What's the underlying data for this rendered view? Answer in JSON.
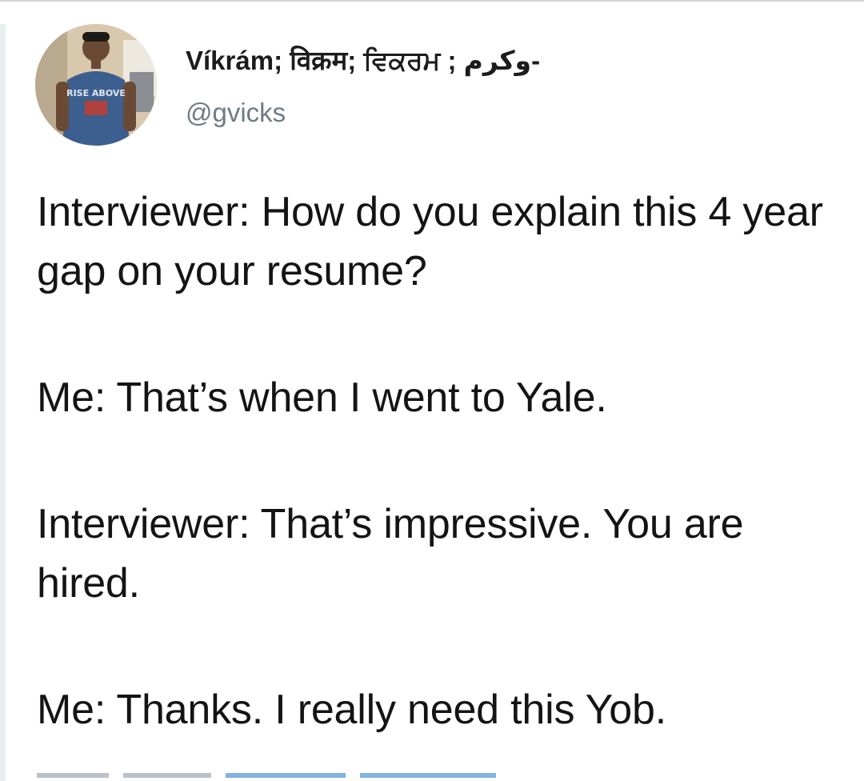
{
  "tweet": {
    "author": {
      "display_name": "Víkrám; विक्रम; ਵਿਕਰਮ ; وکرم-",
      "handle": "@gvicks",
      "avatar_shirt_text": "RISE ABOVE"
    },
    "paragraphs": [
      "Interviewer: How do you explain this 4 year gap on your resume?",
      "Me: That’s when I went to Yale.",
      "Interviewer: That’s impressive. You are hired.",
      "Me: Thanks. I really need this Yob."
    ]
  },
  "colors": {
    "text": "#141414",
    "handle": "#6f7b85",
    "link": "#7fb3e0"
  }
}
